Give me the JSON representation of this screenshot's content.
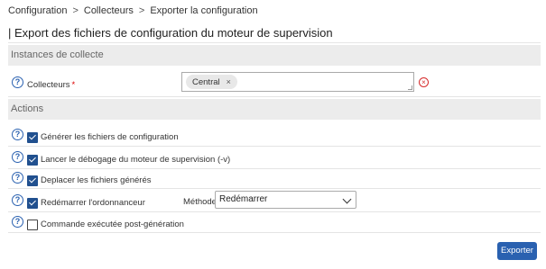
{
  "breadcrumb": {
    "items": [
      "Configuration",
      "Collecteurs",
      "Exporter la configuration"
    ],
    "separator": ">"
  },
  "page": {
    "title": "| Export des fichiers de configuration du moteur de supervision"
  },
  "sections": {
    "instances": "Instances de collecte",
    "actions": "Actions"
  },
  "collectors": {
    "label": "Collecteurs",
    "required_mark": "*",
    "selected_chip": "Central",
    "chip_remove": "×"
  },
  "actions": [
    {
      "label": "Générer les fichiers de configuration",
      "checked": true
    },
    {
      "label": "Lancer le débogage du moteur de supervision (-v)",
      "checked": true
    },
    {
      "label": "Deplacer les fichiers générés",
      "checked": true
    },
    {
      "label": "Redémarrer l'ordonnanceur",
      "checked": true
    },
    {
      "label": "Commande exécutée post-génération",
      "checked": false
    }
  ],
  "method": {
    "label": "Méthode",
    "selected": "Redémarrer"
  },
  "export_button": "Exporter",
  "colors": {
    "accent": "#2a61b0",
    "checkbox": "#21508f",
    "danger": "#d62b2b",
    "section_bg": "#ececec"
  },
  "icons": {
    "help": "question-circle-icon",
    "clear": "close-circle-icon",
    "dropdown": "chevron-down-icon"
  }
}
